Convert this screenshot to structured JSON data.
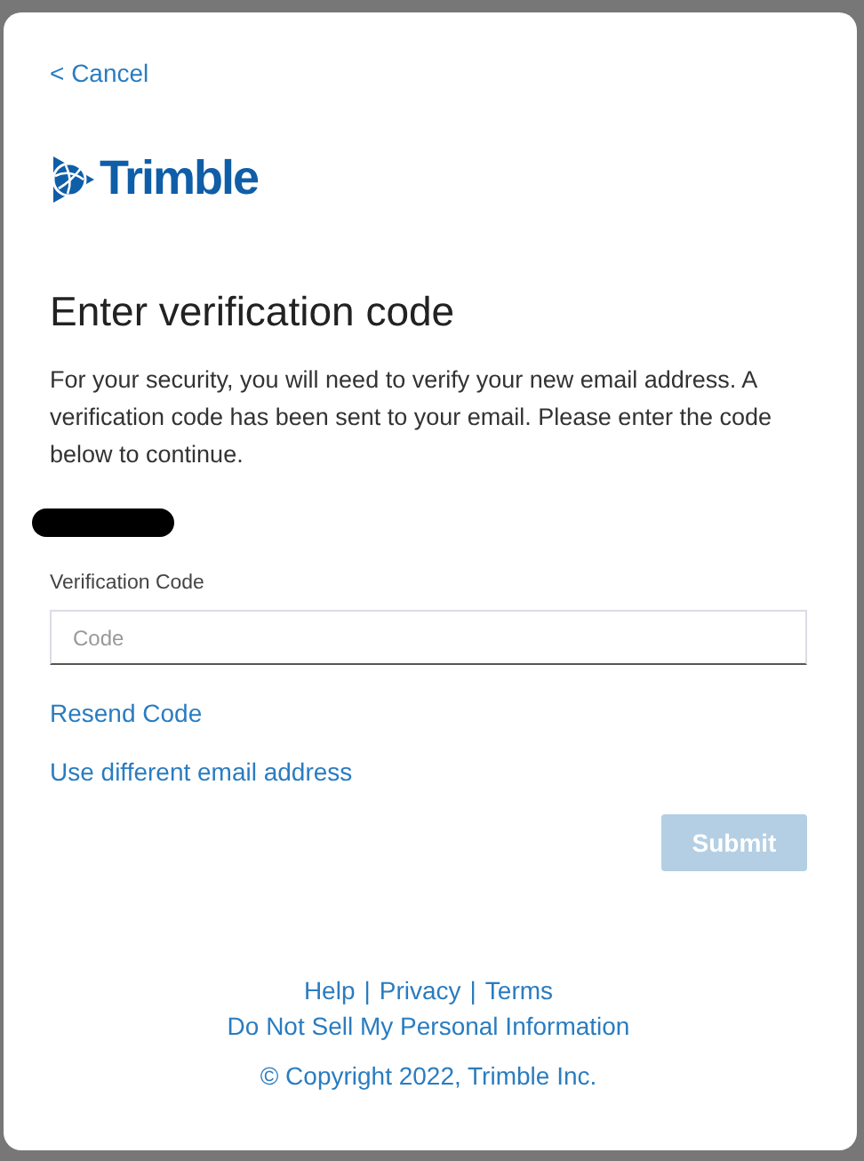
{
  "cancel_link": "< Cancel",
  "logo": {
    "text": "Trimble"
  },
  "heading": "Enter verification code",
  "description": "For your security, you will need to verify your new email address. A verification code has been sent to your email. Please enter the code below to continue.",
  "redacted_email": {
    "kind": "redacted"
  },
  "field": {
    "label": "Verification Code",
    "placeholder": "Code"
  },
  "links": [
    "Resend Code",
    "Use different email address"
  ],
  "submit": {
    "label": "Submit",
    "disabled": true
  },
  "footer": {
    "links": [
      "Help",
      "Privacy",
      "Terms"
    ],
    "separator": "|",
    "privacy_link": "Do Not Sell My Personal Information",
    "copyright": "© Copyright 2022, Trimble Inc."
  }
}
